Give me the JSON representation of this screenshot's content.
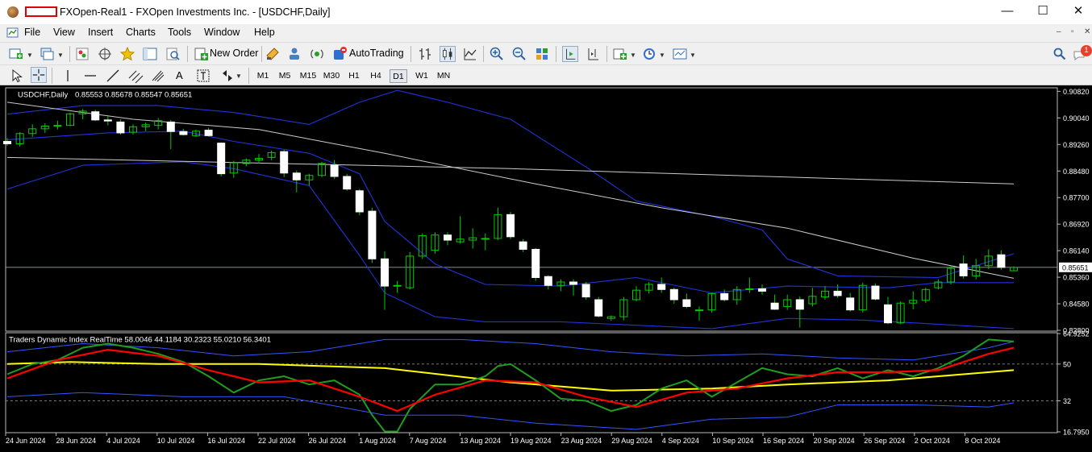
{
  "window": {
    "title": "FXOpen-Real1 - FXOpen Investments Inc. - [USDCHF,Daily]",
    "minimize": "—",
    "maximize": "☐",
    "close": "✕"
  },
  "menu": {
    "items": [
      "File",
      "View",
      "Insert",
      "Charts",
      "Tools",
      "Window",
      "Help"
    ],
    "mdi_minimize": "–",
    "mdi_restore": "▫",
    "mdi_close": "✕"
  },
  "toolbar": {
    "new_order_label": "New Order",
    "autotrading_label": "AutoTrading",
    "notification_count": "1",
    "timeframes": [
      "M1",
      "M5",
      "M15",
      "M30",
      "H1",
      "H4",
      "D1",
      "W1",
      "MN"
    ],
    "active_timeframe": "D1",
    "text_tool": "A"
  },
  "colors": {
    "background": "#000000",
    "bull_candle": "#ffffff",
    "wick": "#00cc00",
    "bollinger": "#2233dd",
    "sma": "#cccccc",
    "tdi_rsi": "#1f9d1f",
    "tdi_signal": "#ff0000",
    "tdi_baseline": "#ffff00",
    "tdi_bands": "#3355ff",
    "accent": "#0078d7"
  },
  "main_chart": {
    "header": "USDCHF,Daily",
    "ohlc": "0.85553 0.85678 0.85547 0.85651",
    "y_ticks": [
      "0.90820",
      "0.90040",
      "0.89260",
      "0.88480",
      "0.87700",
      "0.86920",
      "0.86140",
      "0.85360",
      "0.84580",
      "0.83800"
    ],
    "current_price": "0.85651"
  },
  "indicator": {
    "header": "Traders Dynamic Index RealTime 58.0046 44.1184 30.2323 55.0210 56.3401",
    "y_ticks": [
      "64.9252",
      "50",
      "32",
      "16.7950"
    ]
  },
  "x_labels": [
    "24 Jun 2024",
    "28 Jun 2024",
    "4 Jul 2024",
    "10 Jul 2024",
    "16 Jul 2024",
    "22 Jul 2024",
    "26 Jul 2024",
    "1 Aug 2024",
    "7 Aug 2024",
    "13 Aug 2024",
    "19 Aug 2024",
    "23 Aug 2024",
    "29 Aug 2024",
    "4 Sep 2024",
    "10 Sep 2024",
    "16 Sep 2024",
    "20 Sep 2024",
    "26 Sep 2024",
    "2 Oct 2024",
    "8 Oct 2024"
  ],
  "chart_data": {
    "type": "candlestick",
    "symbol": "USDCHF",
    "timeframe": "Daily",
    "ylim": [
      0.838,
      0.909
    ],
    "candles": [
      {
        "o": 0.8935,
        "h": 0.8945,
        "l": 0.8922,
        "c": 0.8928
      },
      {
        "o": 0.8928,
        "h": 0.8962,
        "l": 0.892,
        "c": 0.8958
      },
      {
        "o": 0.8958,
        "h": 0.8985,
        "l": 0.8948,
        "c": 0.8972
      },
      {
        "o": 0.8972,
        "h": 0.8988,
        "l": 0.896,
        "c": 0.898
      },
      {
        "o": 0.898,
        "h": 0.8996,
        "l": 0.897,
        "c": 0.8982
      },
      {
        "o": 0.8982,
        "h": 0.902,
        "l": 0.898,
        "c": 0.9016
      },
      {
        "o": 0.9016,
        "h": 0.903,
        "l": 0.9,
        "c": 0.9024
      },
      {
        "o": 0.9022,
        "h": 0.9028,
        "l": 0.8995,
        "c": 0.8998
      },
      {
        "o": 0.8998,
        "h": 0.901,
        "l": 0.8982,
        "c": 0.8995
      },
      {
        "o": 0.8992,
        "h": 0.9,
        "l": 0.8955,
        "c": 0.896
      },
      {
        "o": 0.8962,
        "h": 0.8985,
        "l": 0.8955,
        "c": 0.8978
      },
      {
        "o": 0.8978,
        "h": 0.899,
        "l": 0.8965,
        "c": 0.8984
      },
      {
        "o": 0.8982,
        "h": 0.9004,
        "l": 0.897,
        "c": 0.8996
      },
      {
        "o": 0.8992,
        "h": 0.8998,
        "l": 0.8912,
        "c": 0.8964
      },
      {
        "o": 0.8964,
        "h": 0.8972,
        "l": 0.8952,
        "c": 0.8955
      },
      {
        "o": 0.8952,
        "h": 0.897,
        "l": 0.8948,
        "c": 0.8965
      },
      {
        "o": 0.8968,
        "h": 0.8975,
        "l": 0.895,
        "c": 0.8952
      },
      {
        "o": 0.893,
        "h": 0.8932,
        "l": 0.8832,
        "c": 0.884
      },
      {
        "o": 0.8842,
        "h": 0.8878,
        "l": 0.8828,
        "c": 0.8872
      },
      {
        "o": 0.887,
        "h": 0.8885,
        "l": 0.8862,
        "c": 0.888
      },
      {
        "o": 0.888,
        "h": 0.8898,
        "l": 0.887,
        "c": 0.8885
      },
      {
        "o": 0.8888,
        "h": 0.8908,
        "l": 0.888,
        "c": 0.8902
      },
      {
        "o": 0.8905,
        "h": 0.891,
        "l": 0.883,
        "c": 0.8842
      },
      {
        "o": 0.8842,
        "h": 0.885,
        "l": 0.8785,
        "c": 0.8822
      },
      {
        "o": 0.8822,
        "h": 0.884,
        "l": 0.8805,
        "c": 0.8835
      },
      {
        "o": 0.8835,
        "h": 0.8875,
        "l": 0.883,
        "c": 0.887
      },
      {
        "o": 0.8865,
        "h": 0.888,
        "l": 0.8825,
        "c": 0.8832
      },
      {
        "o": 0.8832,
        "h": 0.884,
        "l": 0.879,
        "c": 0.8795
      },
      {
        "o": 0.879,
        "h": 0.8795,
        "l": 0.8718,
        "c": 0.8728
      },
      {
        "o": 0.873,
        "h": 0.874,
        "l": 0.8578,
        "c": 0.859
      },
      {
        "o": 0.859,
        "h": 0.8612,
        "l": 0.844,
        "c": 0.851
      },
      {
        "o": 0.851,
        "h": 0.8525,
        "l": 0.849,
        "c": 0.8512
      },
      {
        "o": 0.8505,
        "h": 0.861,
        "l": 0.85,
        "c": 0.8598
      },
      {
        "o": 0.8598,
        "h": 0.8665,
        "l": 0.859,
        "c": 0.8658
      },
      {
        "o": 0.8615,
        "h": 0.8668,
        "l": 0.8605,
        "c": 0.866
      },
      {
        "o": 0.866,
        "h": 0.8668,
        "l": 0.863,
        "c": 0.8645
      },
      {
        "o": 0.864,
        "h": 0.8715,
        "l": 0.8635,
        "c": 0.8648
      },
      {
        "o": 0.8645,
        "h": 0.868,
        "l": 0.862,
        "c": 0.8652
      },
      {
        "o": 0.8648,
        "h": 0.8665,
        "l": 0.8615,
        "c": 0.865
      },
      {
        "o": 0.865,
        "h": 0.874,
        "l": 0.8645,
        "c": 0.872
      },
      {
        "o": 0.872,
        "h": 0.8728,
        "l": 0.8648,
        "c": 0.8655
      },
      {
        "o": 0.864,
        "h": 0.8648,
        "l": 0.861,
        "c": 0.8618
      },
      {
        "o": 0.8618,
        "h": 0.8622,
        "l": 0.8525,
        "c": 0.8535
      },
      {
        "o": 0.8538,
        "h": 0.8542,
        "l": 0.85,
        "c": 0.8512
      },
      {
        "o": 0.8512,
        "h": 0.853,
        "l": 0.8495,
        "c": 0.8522
      },
      {
        "o": 0.8522,
        "h": 0.853,
        "l": 0.8482,
        "c": 0.8515
      },
      {
        "o": 0.8515,
        "h": 0.8522,
        "l": 0.847,
        "c": 0.8478
      },
      {
        "o": 0.847,
        "h": 0.8478,
        "l": 0.8418,
        "c": 0.8422
      },
      {
        "o": 0.8415,
        "h": 0.8424,
        "l": 0.8408,
        "c": 0.842
      },
      {
        "o": 0.842,
        "h": 0.8478,
        "l": 0.841,
        "c": 0.847
      },
      {
        "o": 0.847,
        "h": 0.851,
        "l": 0.8465,
        "c": 0.8498
      },
      {
        "o": 0.8498,
        "h": 0.8522,
        "l": 0.8488,
        "c": 0.8515
      },
      {
        "o": 0.8515,
        "h": 0.8535,
        "l": 0.849,
        "c": 0.85
      },
      {
        "o": 0.85,
        "h": 0.8505,
        "l": 0.8458,
        "c": 0.847
      },
      {
        "o": 0.847,
        "h": 0.8488,
        "l": 0.8445,
        "c": 0.845
      },
      {
        "o": 0.844,
        "h": 0.845,
        "l": 0.8408,
        "c": 0.844
      },
      {
        "o": 0.844,
        "h": 0.849,
        "l": 0.8432,
        "c": 0.8488
      },
      {
        "o": 0.8488,
        "h": 0.85,
        "l": 0.8465,
        "c": 0.847
      },
      {
        "o": 0.847,
        "h": 0.851,
        "l": 0.8455,
        "c": 0.85
      },
      {
        "o": 0.85,
        "h": 0.8535,
        "l": 0.849,
        "c": 0.8502
      },
      {
        "o": 0.8502,
        "h": 0.8515,
        "l": 0.8485,
        "c": 0.8495
      },
      {
        "o": 0.846,
        "h": 0.8485,
        "l": 0.844,
        "c": 0.8442
      },
      {
        "o": 0.845,
        "h": 0.8485,
        "l": 0.844,
        "c": 0.847
      },
      {
        "o": 0.847,
        "h": 0.848,
        "l": 0.8388,
        "c": 0.8442
      },
      {
        "o": 0.8458,
        "h": 0.8505,
        "l": 0.845,
        "c": 0.848
      },
      {
        "o": 0.8478,
        "h": 0.851,
        "l": 0.847,
        "c": 0.8495
      },
      {
        "o": 0.8495,
        "h": 0.8515,
        "l": 0.8475,
        "c": 0.8482
      },
      {
        "o": 0.8475,
        "h": 0.849,
        "l": 0.8435,
        "c": 0.844
      },
      {
        "o": 0.844,
        "h": 0.852,
        "l": 0.8432,
        "c": 0.8512
      },
      {
        "o": 0.851,
        "h": 0.8518,
        "l": 0.8468,
        "c": 0.8472
      },
      {
        "o": 0.8455,
        "h": 0.8478,
        "l": 0.8398,
        "c": 0.8402
      },
      {
        "o": 0.8402,
        "h": 0.8465,
        "l": 0.8398,
        "c": 0.846
      },
      {
        "o": 0.846,
        "h": 0.8495,
        "l": 0.8442,
        "c": 0.8468
      },
      {
        "o": 0.8468,
        "h": 0.8505,
        "l": 0.846,
        "c": 0.85
      },
      {
        "o": 0.8505,
        "h": 0.853,
        "l": 0.85,
        "c": 0.8522
      },
      {
        "o": 0.8522,
        "h": 0.857,
        "l": 0.8515,
        "c": 0.8562
      },
      {
        "o": 0.8575,
        "h": 0.86,
        "l": 0.8532,
        "c": 0.854
      },
      {
        "o": 0.854,
        "h": 0.859,
        "l": 0.853,
        "c": 0.857
      },
      {
        "o": 0.857,
        "h": 0.8618,
        "l": 0.856,
        "c": 0.8598
      },
      {
        "o": 0.8602,
        "h": 0.8615,
        "l": 0.8558,
        "c": 0.8565
      },
      {
        "o": 0.8555,
        "h": 0.8568,
        "l": 0.8555,
        "c": 0.8565
      }
    ],
    "sma_slow": [
      [
        0,
        0.8888
      ],
      [
        40,
        0.8855
      ],
      [
        80,
        0.881
      ]
    ],
    "sma_mid": [
      [
        0,
        0.905
      ],
      [
        10,
        0.9
      ],
      [
        20,
        0.897
      ],
      [
        30,
        0.89
      ],
      [
        42,
        0.881
      ],
      [
        52,
        0.874
      ],
      [
        62,
        0.868
      ],
      [
        72,
        0.8592
      ],
      [
        80,
        0.8533
      ]
    ],
    "bb_upper": [
      [
        0,
        0.9015
      ],
      [
        6,
        0.904
      ],
      [
        12,
        0.904
      ],
      [
        18,
        0.902
      ],
      [
        24,
        0.8985
      ],
      [
        28,
        0.905
      ],
      [
        31,
        0.9085
      ],
      [
        35,
        0.905
      ],
      [
        40,
        0.9
      ],
      [
        46,
        0.886
      ],
      [
        50,
        0.876
      ],
      [
        56,
        0.8715
      ],
      [
        60,
        0.8675
      ],
      [
        62,
        0.859
      ],
      [
        66,
        0.854
      ],
      [
        74,
        0.8535
      ],
      [
        80,
        0.8605
      ]
    ],
    "bb_mid": [
      [
        0,
        0.894
      ],
      [
        8,
        0.896
      ],
      [
        14,
        0.8965
      ],
      [
        18,
        0.8935
      ],
      [
        24,
        0.89
      ],
      [
        28,
        0.884
      ],
      [
        30,
        0.87
      ],
      [
        34,
        0.8575
      ],
      [
        38,
        0.8515
      ],
      [
        44,
        0.851
      ],
      [
        50,
        0.8535
      ],
      [
        56,
        0.849
      ],
      [
        62,
        0.851
      ],
      [
        70,
        0.8505
      ],
      [
        74,
        0.852
      ],
      [
        80,
        0.852
      ]
    ],
    "bb_lower": [
      [
        0,
        0.8795
      ],
      [
        6,
        0.8865
      ],
      [
        14,
        0.8875
      ],
      [
        18,
        0.8855
      ],
      [
        24,
        0.8805
      ],
      [
        28,
        0.86
      ],
      [
        30,
        0.849
      ],
      [
        34,
        0.842
      ],
      [
        38,
        0.8405
      ],
      [
        44,
        0.8405
      ],
      [
        50,
        0.8395
      ],
      [
        56,
        0.8385
      ],
      [
        62,
        0.8415
      ],
      [
        68,
        0.841
      ],
      [
        74,
        0.8398
      ],
      [
        80,
        0.8385
      ]
    ],
    "tdi": {
      "ylim": [
        16.795,
        64.9252
      ],
      "levels": [
        50,
        32
      ],
      "rsi": [
        [
          0,
          45
        ],
        [
          2,
          50
        ],
        [
          4,
          52
        ],
        [
          6,
          58
        ],
        [
          8,
          60
        ],
        [
          10,
          58
        ],
        [
          12,
          55
        ],
        [
          14,
          51
        ],
        [
          16,
          44
        ],
        [
          18,
          36
        ],
        [
          20,
          42
        ],
        [
          22,
          44
        ],
        [
          24,
          40
        ],
        [
          26,
          42
        ],
        [
          28,
          35
        ],
        [
          29,
          25
        ],
        [
          30,
          17
        ],
        [
          31,
          17
        ],
        [
          32,
          28
        ],
        [
          34,
          40
        ],
        [
          36,
          40
        ],
        [
          38,
          44
        ],
        [
          39,
          49
        ],
        [
          40,
          50
        ],
        [
          42,
          42
        ],
        [
          44,
          33
        ],
        [
          46,
          32
        ],
        [
          48,
          27
        ],
        [
          50,
          30
        ],
        [
          52,
          38
        ],
        [
          54,
          42
        ],
        [
          56,
          34
        ],
        [
          58,
          41
        ],
        [
          60,
          48
        ],
        [
          62,
          45
        ],
        [
          64,
          44
        ],
        [
          66,
          48
        ],
        [
          68,
          43
        ],
        [
          70,
          47
        ],
        [
          72,
          44
        ],
        [
          74,
          48
        ],
        [
          76,
          54
        ],
        [
          78,
          62
        ],
        [
          80,
          61
        ]
      ],
      "signal": [
        [
          0,
          43
        ],
        [
          4,
          52
        ],
        [
          8,
          57
        ],
        [
          12,
          54
        ],
        [
          16,
          47
        ],
        [
          20,
          41
        ],
        [
          24,
          42
        ],
        [
          28,
          34
        ],
        [
          31,
          27
        ],
        [
          34,
          35
        ],
        [
          38,
          42
        ],
        [
          42,
          41
        ],
        [
          46,
          34
        ],
        [
          50,
          29
        ],
        [
          54,
          36
        ],
        [
          58,
          38
        ],
        [
          62,
          43
        ],
        [
          66,
          46
        ],
        [
          70,
          46
        ],
        [
          74,
          47
        ],
        [
          78,
          55
        ],
        [
          80,
          58
        ]
      ],
      "baseline": [
        [
          0,
          50
        ],
        [
          5,
          51
        ],
        [
          12,
          50
        ],
        [
          20,
          50
        ],
        [
          30,
          48
        ],
        [
          40,
          41
        ],
        [
          48,
          37
        ],
        [
          56,
          38
        ],
        [
          62,
          40
        ],
        [
          70,
          42
        ],
        [
          76,
          45
        ],
        [
          80,
          47
        ]
      ],
      "upper_band": [
        [
          0,
          56
        ],
        [
          6,
          60
        ],
        [
          12,
          58
        ],
        [
          18,
          54
        ],
        [
          24,
          56
        ],
        [
          30,
          62
        ],
        [
          36,
          62
        ],
        [
          42,
          60
        ],
        [
          48,
          56
        ],
        [
          54,
          54
        ],
        [
          60,
          55
        ],
        [
          66,
          53
        ],
        [
          72,
          52
        ],
        [
          78,
          58
        ],
        [
          80,
          61
        ]
      ],
      "lower_band": [
        [
          0,
          34
        ],
        [
          6,
          36
        ],
        [
          14,
          34
        ],
        [
          22,
          34
        ],
        [
          30,
          25
        ],
        [
          36,
          25
        ],
        [
          42,
          21
        ],
        [
          50,
          18
        ],
        [
          56,
          23
        ],
        [
          62,
          24
        ],
        [
          66,
          30
        ],
        [
          72,
          30
        ],
        [
          78,
          29
        ],
        [
          80,
          31
        ]
      ]
    }
  }
}
